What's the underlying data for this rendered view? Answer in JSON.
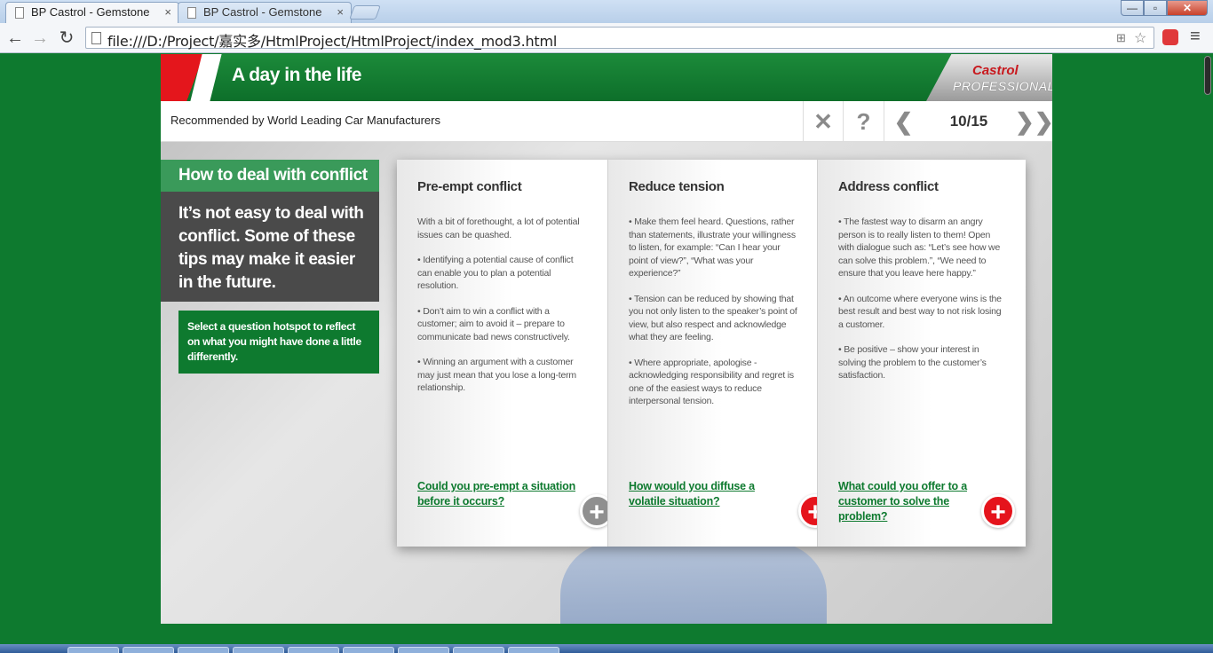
{
  "browser": {
    "tabs": [
      {
        "title": "BP Castrol - Gemstone",
        "active": true
      },
      {
        "title": "BP Castrol - Gemstone",
        "active": false
      }
    ],
    "tab_close_glyph": "×",
    "url": "file:///D:/Project/嘉实多/HtmlProject/HtmlProject/index_mod3.html",
    "window_controls": {
      "minimize": "—",
      "maximize": "▫",
      "close": "✕"
    },
    "nav": {
      "back": "←",
      "forward": "→",
      "reload": "↻"
    },
    "icons": {
      "translate": "translate-icon",
      "bookmark": "☆",
      "menu": "≡"
    }
  },
  "course": {
    "header_title": "A day in the life",
    "logo": {
      "brand": "Castrol",
      "line": "PROFESSIONAL"
    },
    "subtitle": "Recommended by World Leading Car Manufacturers",
    "controls": {
      "close": "✕",
      "help": "?",
      "prev": "❮",
      "next": "❯❯",
      "page": "10/15"
    },
    "intro": {
      "heading": "How to deal with conflict",
      "body": "It’s not easy to deal with conflict. Some of these tips may make it easier in the future.",
      "hint": "Select a question hotspot to reflect on what you might have done a little differently."
    },
    "panels": [
      {
        "title": "Pre-empt conflict",
        "paragraphs": [
          "With a bit of forethought, a lot of potential issues can be quashed.",
          "• Identifying a potential cause of conflict can enable you to plan a potential resolution.",
          "• Don’t aim to win a conflict with a customer; aim to avoid it – prepare to communicate bad news constructively.",
          "• Winning an argument with a customer may just mean that you lose a long-term relationship."
        ],
        "question": "Could you pre-empt a situation before it occurs?",
        "hotspot": "+",
        "hotspot_state": "visited"
      },
      {
        "title": "Reduce tension",
        "paragraphs": [
          "• Make them feel heard. Questions, rather than statements, illustrate your willingness to listen, for example: “Can I hear your point of view?”, “What was your experience?”",
          "• Tension can be reduced by showing that you not only listen to the speaker’s point of view, but also respect and acknowledge what they are feeling.",
          "• Where appropriate, apologise - acknowledging responsibility and regret is one of the easiest ways to reduce interpersonal tension."
        ],
        "question": "How would you diffuse a volatile situation?",
        "hotspot": "+",
        "hotspot_state": "new"
      },
      {
        "title": "Address conflict",
        "paragraphs": [
          "• The fastest way to disarm an angry person is to really listen to them! Open with  dialogue such as: “Let’s see how we can solve this problem.”, “We need to ensure that you leave here happy.”",
          "• An outcome where everyone wins is the best result and best way to not risk losing a customer.",
          "• Be positive – show your interest in solving the problem to the customer’s satisfaction."
        ],
        "question": "What could you offer to a customer to solve the problem?",
        "hotspot": "+",
        "hotspot_state": "new"
      }
    ]
  },
  "colors": {
    "brand_green": "#0e7a2f",
    "brand_red": "#e5141c",
    "hotspot_grey": "#8f8f8f"
  }
}
